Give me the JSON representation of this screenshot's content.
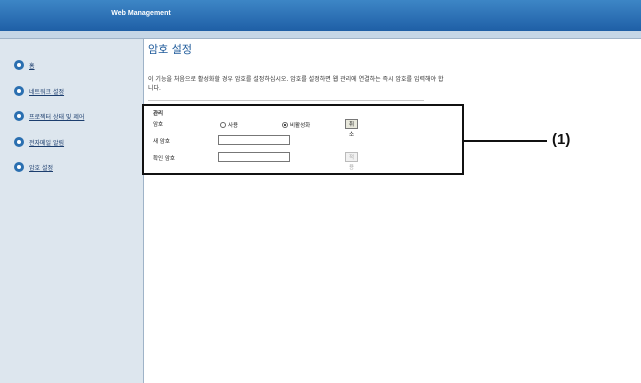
{
  "header": {
    "title": "Web Management"
  },
  "sidebar": {
    "items": [
      {
        "label": "홈"
      },
      {
        "label": "네트워크 설정"
      },
      {
        "label": "프로젝터 상태 및 제어"
      },
      {
        "label": "전자메일 알림"
      },
      {
        "label": "암호 설정"
      }
    ]
  },
  "main": {
    "title": "암호 설정",
    "description": "이 기능을 처음으로 활성화할 경우 암호를 설정하십시오. 암호를 설정하면 웹 관리에 연결하는 즉시 암호를 입력해야 합니다.",
    "section_label": "관리",
    "password_label": "암호",
    "radio_enable": "사용",
    "radio_disable": "비활성화",
    "selected_radio": "비활성화",
    "cancel_button": "취소",
    "new_password_label": "새 암호",
    "new_password_value": "",
    "confirm_password_label": "확인 암호",
    "confirm_password_value": "",
    "apply_button": "적용"
  },
  "callout": {
    "label": "(1)"
  },
  "colors": {
    "header": "#1f5fa6",
    "sidebar": "#dde6ee",
    "title": "#1e5a9a",
    "icon": "#2a6fb0"
  }
}
